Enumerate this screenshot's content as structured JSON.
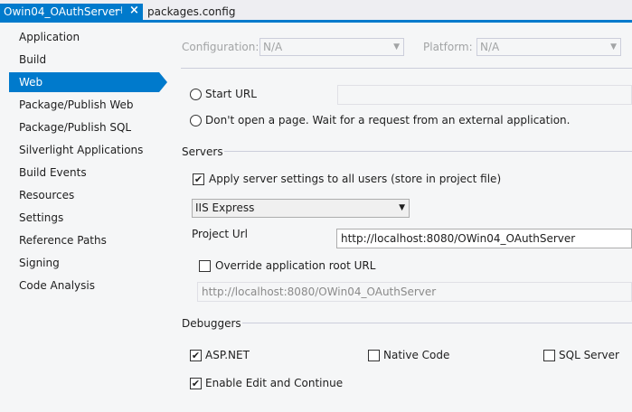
{
  "tabs": {
    "active_title": "Owin04_OAuthServer",
    "pin_glyph": "⊣",
    "close_glyph": "×",
    "inactive_title": "packages.config"
  },
  "sidebar": {
    "items": [
      {
        "label": "Application"
      },
      {
        "label": "Build"
      },
      {
        "label": "Web"
      },
      {
        "label": "Package/Publish Web"
      },
      {
        "label": "Package/Publish SQL"
      },
      {
        "label": "Silverlight Applications"
      },
      {
        "label": "Build Events"
      },
      {
        "label": "Resources"
      },
      {
        "label": "Settings"
      },
      {
        "label": "Reference Paths"
      },
      {
        "label": "Signing"
      },
      {
        "label": "Code Analysis"
      }
    ],
    "selected": "Web"
  },
  "config": {
    "configuration_label": "Configuration:",
    "configuration_value": "N/A",
    "platform_label": "Platform:",
    "platform_value": "N/A"
  },
  "start_action": {
    "start_url_label": "Start URL",
    "start_url_value": "",
    "dont_open_label": "Don't open a page.  Wait for a request from an external application."
  },
  "servers": {
    "section_title": "Servers",
    "apply_all_label": "Apply server settings to all users (store in project file)",
    "apply_all_checked": true,
    "server_value": "IIS Express",
    "project_url_label": "Project Url",
    "project_url_value": "http://localhost:8080/OWin04_OAuthServer",
    "override_label": "Override application root URL",
    "override_checked": false,
    "override_value": "http://localhost:8080/OWin04_OAuthServer"
  },
  "debuggers": {
    "section_title": "Debuggers",
    "aspnet_label": "ASP.NET",
    "aspnet_checked": true,
    "native_label": "Native Code",
    "native_checked": false,
    "sql_label": "SQL Server",
    "sql_checked": false,
    "edit_continue_label": "Enable Edit and Continue",
    "edit_continue_checked": true
  },
  "check_glyph": "✔",
  "dropdown_glyph": "▼",
  "colors": {
    "accent": "#007acc",
    "background": "#f5f6f7"
  }
}
